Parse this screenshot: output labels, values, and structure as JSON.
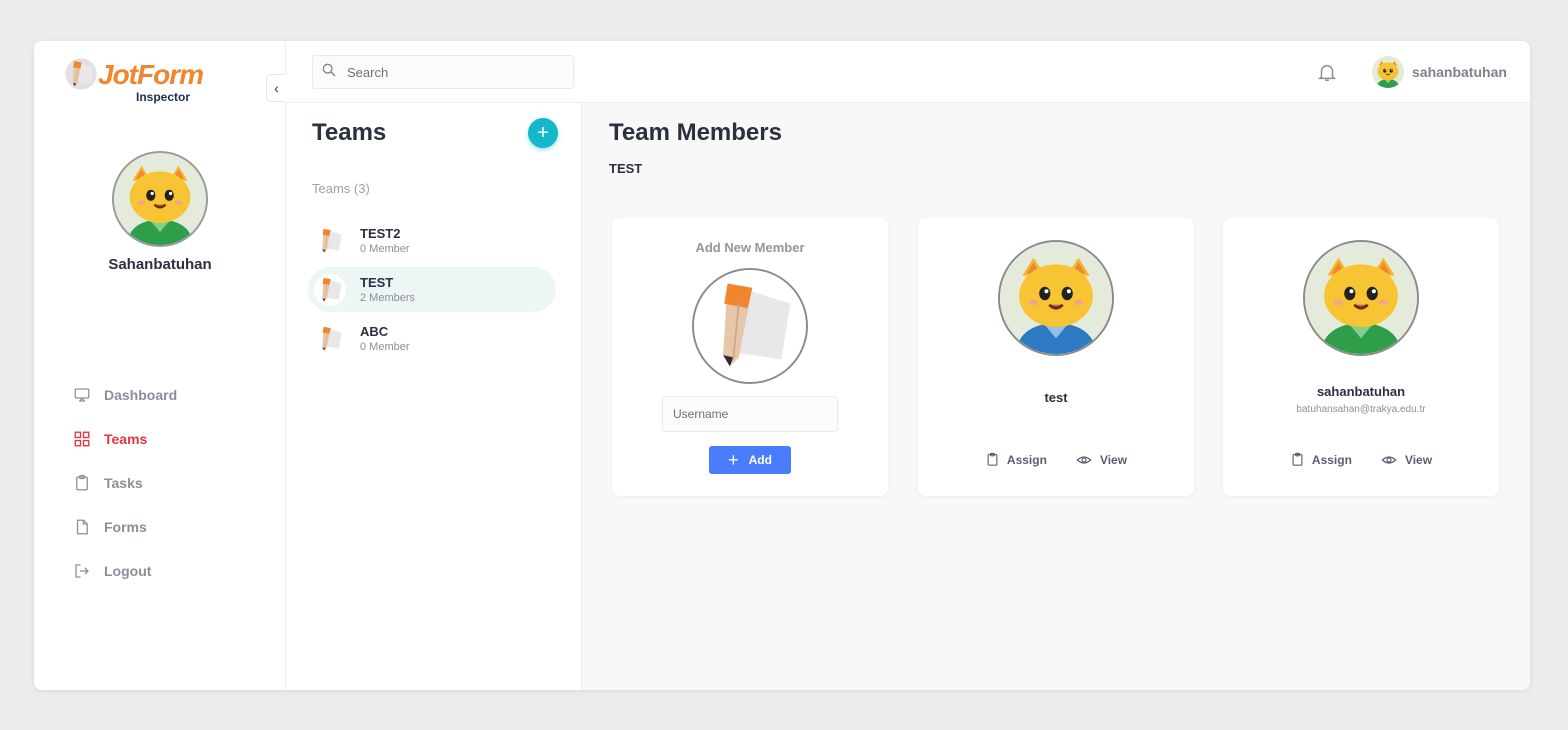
{
  "brand": {
    "name": "JotForm",
    "sub": "Inspector",
    "color": "#f0862e"
  },
  "sidebar": {
    "collapse_icon": "‹",
    "profile_name": "Sahanbatuhan",
    "items": [
      {
        "label": "Dashboard",
        "icon": "monitor-icon"
      },
      {
        "label": "Teams",
        "icon": "grid-icon",
        "active": true
      },
      {
        "label": "Tasks",
        "icon": "clipboard-icon"
      },
      {
        "label": "Forms",
        "icon": "file-icon"
      },
      {
        "label": "Logout",
        "icon": "logout-icon"
      }
    ]
  },
  "topbar": {
    "search_placeholder": "Search",
    "username": "sahanbatuhan"
  },
  "teams": {
    "title": "Teams",
    "count_label": "Teams (3)",
    "list": [
      {
        "name": "TEST2",
        "members": "0 Member"
      },
      {
        "name": "TEST",
        "members": "2 Members",
        "active": true
      },
      {
        "name": "ABC",
        "members": "0 Member"
      }
    ]
  },
  "main": {
    "title": "Team Members",
    "team_name": "TEST",
    "add_card": {
      "heading": "Add New Member",
      "input_placeholder": "Username",
      "button_label": "Add"
    },
    "members": [
      {
        "name": "test",
        "email": "",
        "assign_label": "Assign",
        "view_label": "View",
        "shirt_color": "#2e7bc4"
      },
      {
        "name": "sahanbatuhan",
        "email": "batuhansahan@trakya.edu.tr",
        "assign_label": "Assign",
        "view_label": "View",
        "shirt_color": "#2e9e4a"
      }
    ]
  },
  "colors": {
    "accent_red": "#e63444",
    "teal": "#14b8c8",
    "primary_blue": "#4a7dfd"
  }
}
